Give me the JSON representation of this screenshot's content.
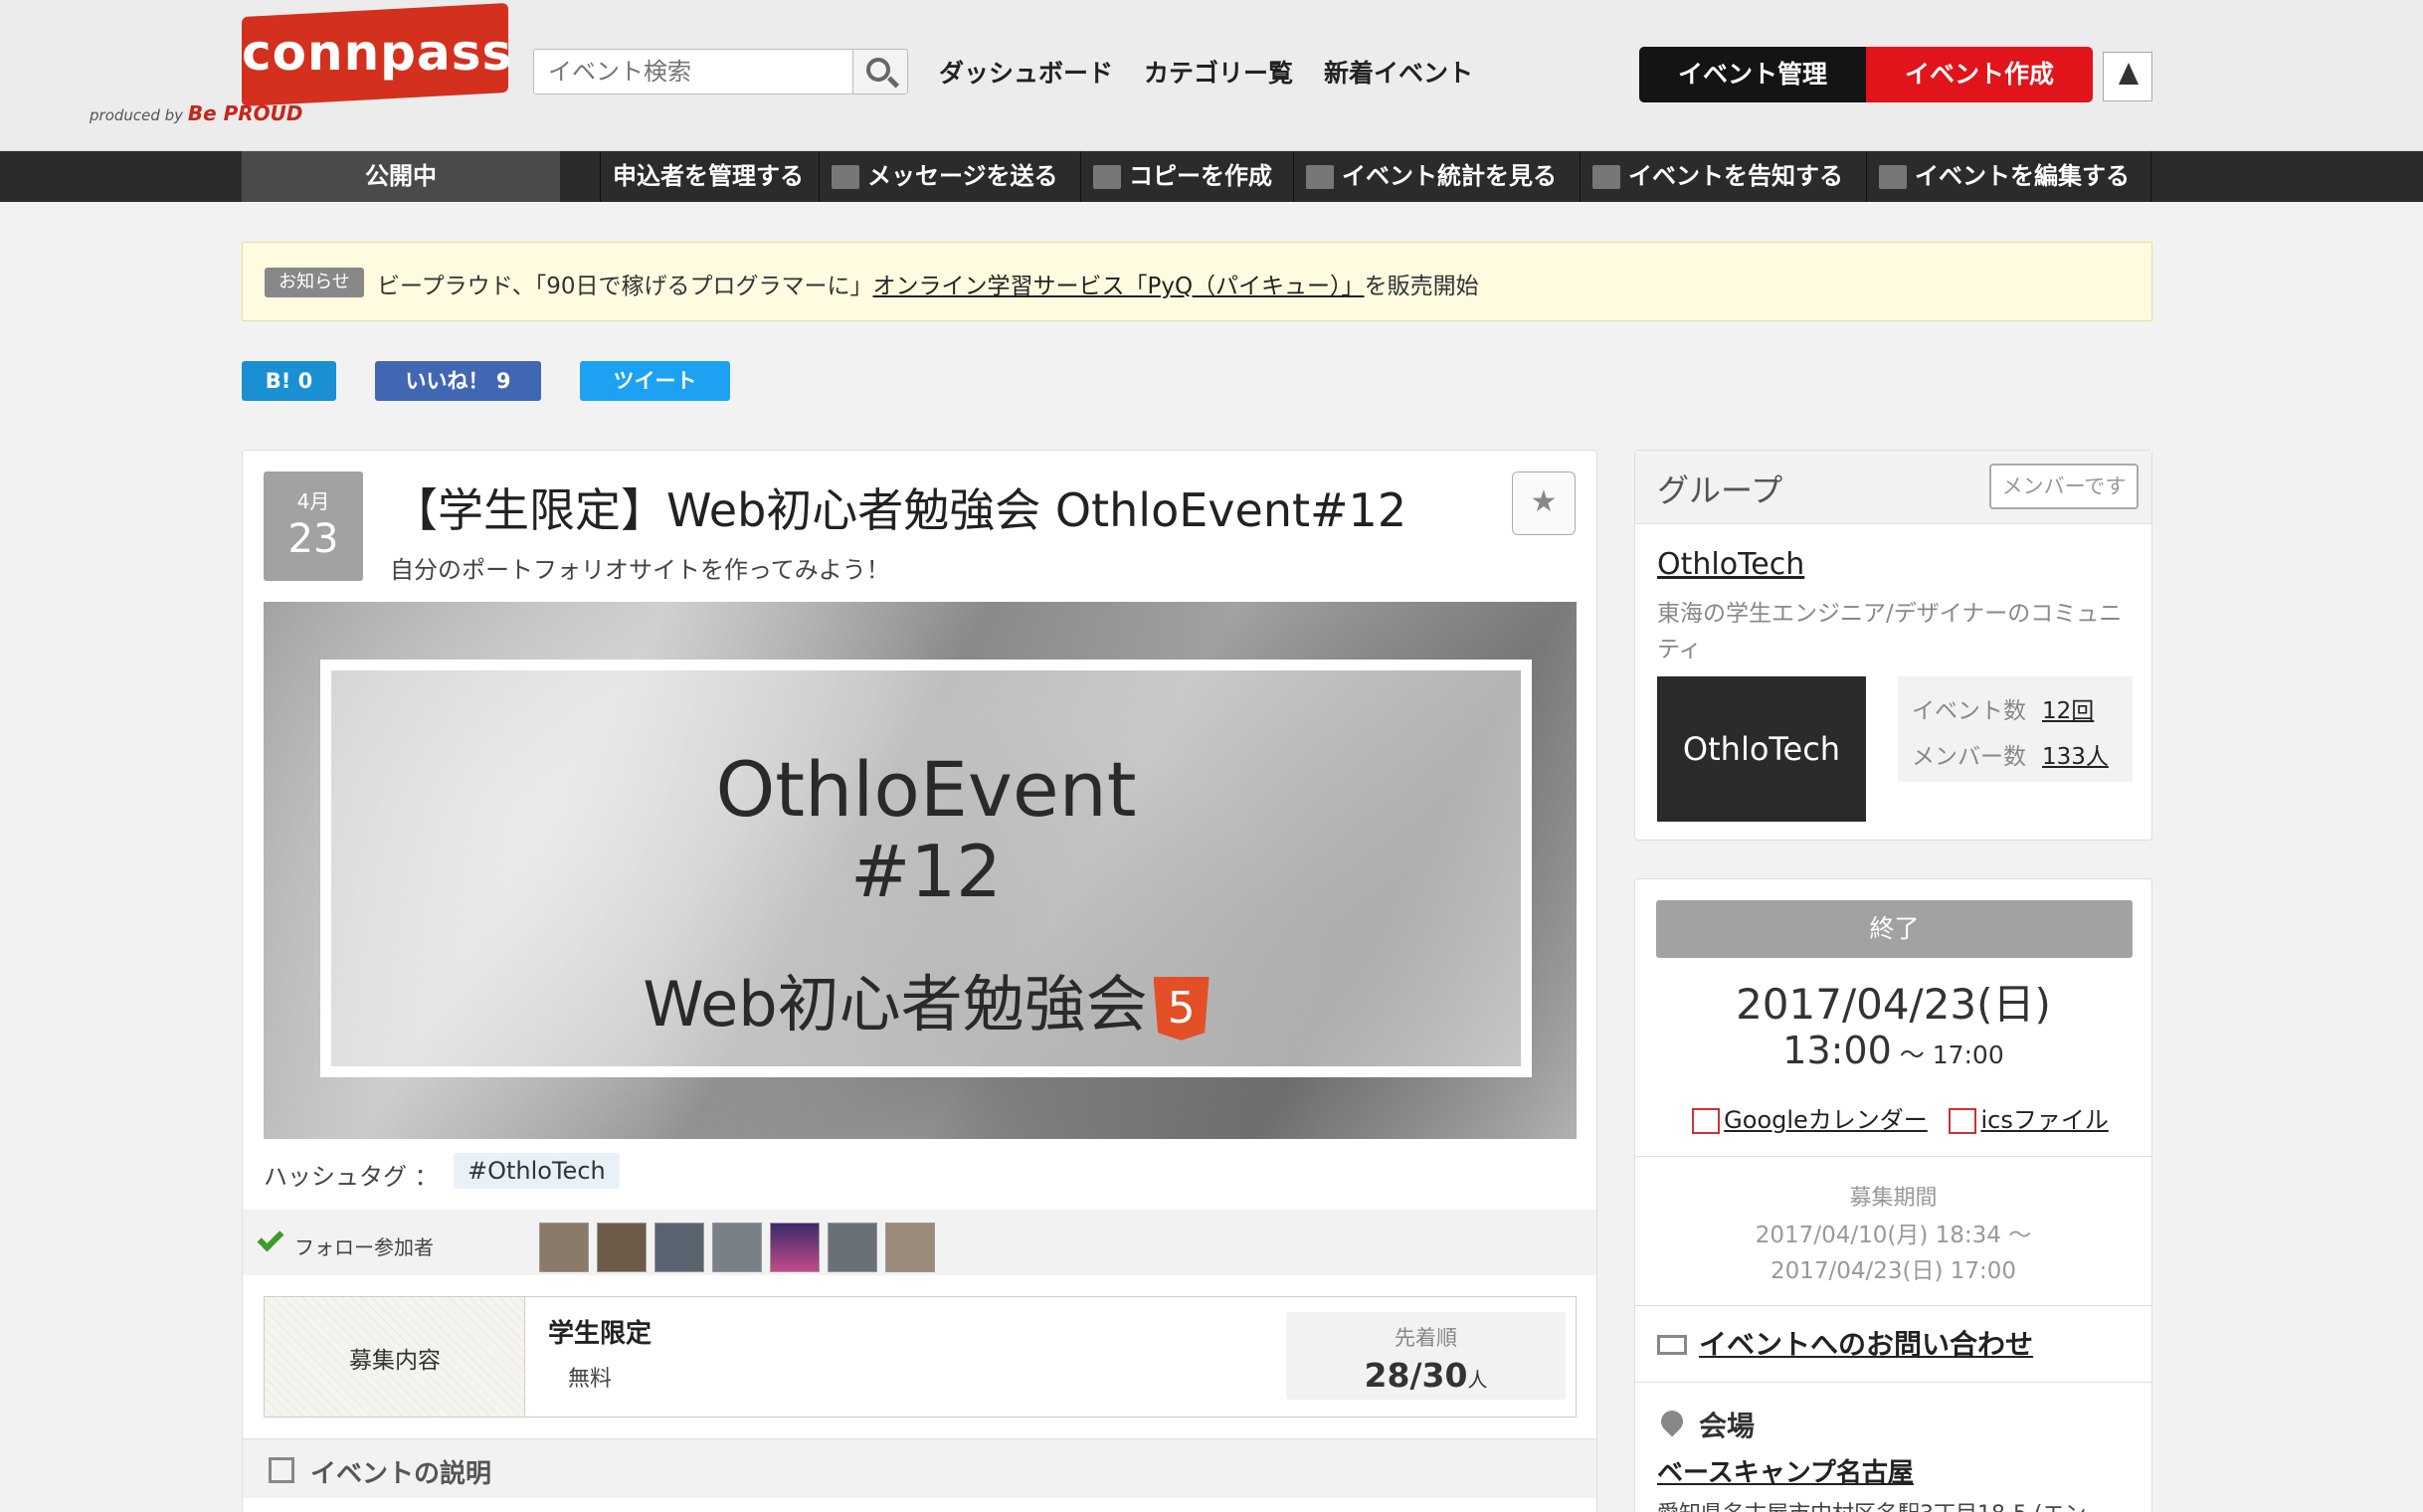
{
  "header": {
    "logo_text": "connpass",
    "logo_sub": "produced by",
    "logo_brand": "Be PROUD",
    "search_placeholder": "イベント検索",
    "nav": [
      "ダッシュボード",
      "カテゴリー覧",
      "新着イベント"
    ],
    "manage_label": "イベント管理",
    "create_label": "イベント作成"
  },
  "subnav": {
    "status": "公開中",
    "items": [
      "申込者を管理する",
      "メッセージを送る",
      "コピーを作成",
      "イベント統計を見る",
      "イベントを告知する",
      "イベントを編集する"
    ]
  },
  "notice": {
    "badge": "お知らせ",
    "text_before": "ビープラウド、「90日で稼げるプログラマーに」",
    "link": "オンライン学習サービス「PyQ（パイキュー）」",
    "text_after": "を販売開始"
  },
  "social": {
    "hatena": "B! 0",
    "like": "いいね！ 9",
    "tweet": "ツイート"
  },
  "event": {
    "month": "4月",
    "day": "23",
    "title": "【学生限定】Web初心者勉強会 OthloEvent#12",
    "subtitle": "自分のポートフォリオサイトを作ってみよう！",
    "bookmark_icon": "★",
    "hero_line1": "OthloEvent",
    "hero_line2": "#12",
    "hero_line3": "Web初心者勉強会",
    "html5_badge": "5",
    "hashtag_label": "ハッシュタグ ：",
    "hashtag": "#OthloTech",
    "follow_label": "フォロー参加者",
    "recruit_label": "募集内容",
    "recruit_name": "学生限定",
    "recruit_fee": "無料",
    "recruit_order": "先着順",
    "recruit_count": "28/30",
    "recruit_unit": "人",
    "desc_title": "イベントの説明"
  },
  "group": {
    "title": "グループ",
    "member_button": "メンバーです",
    "name": "OthloTech",
    "description": "東海の学生エンジニア/デザイナーのコミュニティ",
    "logo_text": "OthloTech",
    "events_label": "イベント数",
    "events_value": "12回",
    "members_label": "メンバー数",
    "members_value": "133人"
  },
  "info": {
    "status": "終了",
    "date": "2017/04/23(日)",
    "time_start": "13:00",
    "time_sep": " ～ ",
    "time_end": "17:00",
    "google_cal": "Googleカレンダー",
    "ics": "icsファイル",
    "period_label": "募集期間",
    "period_start": "2017/04/10(月) 18:34 ～",
    "period_end": "2017/04/23(日) 17:00",
    "contact": "イベントへのお問い合わせ",
    "venue_label": "会場",
    "venue_name": "ベースキャンプ名古屋",
    "venue_address": "愛知県名古屋市中村区名駅3丁目18-5 (エン"
  },
  "colors": {
    "brand_red": "#d3301e",
    "create_red": "#e0141a"
  }
}
